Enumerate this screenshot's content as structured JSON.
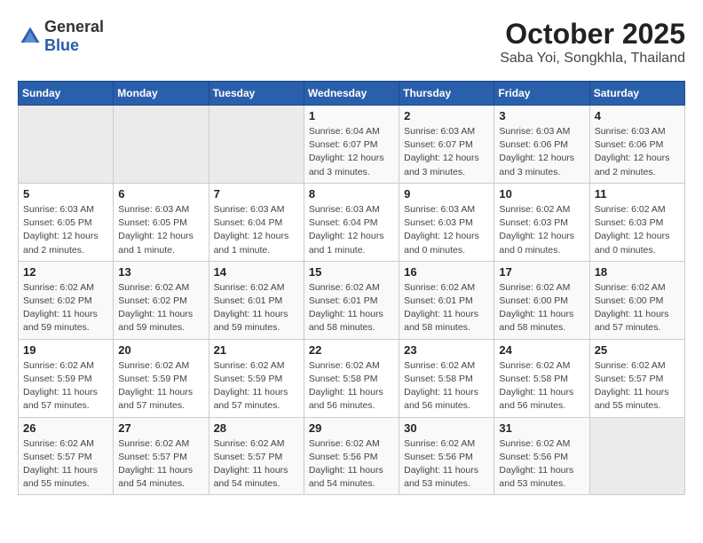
{
  "header": {
    "logo": {
      "general": "General",
      "blue": "Blue"
    },
    "title": "October 2025",
    "subtitle": "Saba Yoi, Songkhla, Thailand"
  },
  "calendar": {
    "weekdays": [
      "Sunday",
      "Monday",
      "Tuesday",
      "Wednesday",
      "Thursday",
      "Friday",
      "Saturday"
    ],
    "weeks": [
      [
        {
          "day": "",
          "empty": true
        },
        {
          "day": "",
          "empty": true
        },
        {
          "day": "",
          "empty": true
        },
        {
          "day": "1",
          "sunrise": "6:04 AM",
          "sunset": "6:07 PM",
          "daylight": "12 hours and 3 minutes."
        },
        {
          "day": "2",
          "sunrise": "6:03 AM",
          "sunset": "6:07 PM",
          "daylight": "12 hours and 3 minutes."
        },
        {
          "day": "3",
          "sunrise": "6:03 AM",
          "sunset": "6:06 PM",
          "daylight": "12 hours and 3 minutes."
        },
        {
          "day": "4",
          "sunrise": "6:03 AM",
          "sunset": "6:06 PM",
          "daylight": "12 hours and 2 minutes."
        }
      ],
      [
        {
          "day": "5",
          "sunrise": "6:03 AM",
          "sunset": "6:05 PM",
          "daylight": "12 hours and 2 minutes."
        },
        {
          "day": "6",
          "sunrise": "6:03 AM",
          "sunset": "6:05 PM",
          "daylight": "12 hours and 1 minute."
        },
        {
          "day": "7",
          "sunrise": "6:03 AM",
          "sunset": "6:04 PM",
          "daylight": "12 hours and 1 minute."
        },
        {
          "day": "8",
          "sunrise": "6:03 AM",
          "sunset": "6:04 PM",
          "daylight": "12 hours and 1 minute."
        },
        {
          "day": "9",
          "sunrise": "6:03 AM",
          "sunset": "6:03 PM",
          "daylight": "12 hours and 0 minutes."
        },
        {
          "day": "10",
          "sunrise": "6:02 AM",
          "sunset": "6:03 PM",
          "daylight": "12 hours and 0 minutes."
        },
        {
          "day": "11",
          "sunrise": "6:02 AM",
          "sunset": "6:03 PM",
          "daylight": "12 hours and 0 minutes."
        }
      ],
      [
        {
          "day": "12",
          "sunrise": "6:02 AM",
          "sunset": "6:02 PM",
          "daylight": "11 hours and 59 minutes."
        },
        {
          "day": "13",
          "sunrise": "6:02 AM",
          "sunset": "6:02 PM",
          "daylight": "11 hours and 59 minutes."
        },
        {
          "day": "14",
          "sunrise": "6:02 AM",
          "sunset": "6:01 PM",
          "daylight": "11 hours and 59 minutes."
        },
        {
          "day": "15",
          "sunrise": "6:02 AM",
          "sunset": "6:01 PM",
          "daylight": "11 hours and 58 minutes."
        },
        {
          "day": "16",
          "sunrise": "6:02 AM",
          "sunset": "6:01 PM",
          "daylight": "11 hours and 58 minutes."
        },
        {
          "day": "17",
          "sunrise": "6:02 AM",
          "sunset": "6:00 PM",
          "daylight": "11 hours and 58 minutes."
        },
        {
          "day": "18",
          "sunrise": "6:02 AM",
          "sunset": "6:00 PM",
          "daylight": "11 hours and 57 minutes."
        }
      ],
      [
        {
          "day": "19",
          "sunrise": "6:02 AM",
          "sunset": "5:59 PM",
          "daylight": "11 hours and 57 minutes."
        },
        {
          "day": "20",
          "sunrise": "6:02 AM",
          "sunset": "5:59 PM",
          "daylight": "11 hours and 57 minutes."
        },
        {
          "day": "21",
          "sunrise": "6:02 AM",
          "sunset": "5:59 PM",
          "daylight": "11 hours and 57 minutes."
        },
        {
          "day": "22",
          "sunrise": "6:02 AM",
          "sunset": "5:58 PM",
          "daylight": "11 hours and 56 minutes."
        },
        {
          "day": "23",
          "sunrise": "6:02 AM",
          "sunset": "5:58 PM",
          "daylight": "11 hours and 56 minutes."
        },
        {
          "day": "24",
          "sunrise": "6:02 AM",
          "sunset": "5:58 PM",
          "daylight": "11 hours and 56 minutes."
        },
        {
          "day": "25",
          "sunrise": "6:02 AM",
          "sunset": "5:57 PM",
          "daylight": "11 hours and 55 minutes."
        }
      ],
      [
        {
          "day": "26",
          "sunrise": "6:02 AM",
          "sunset": "5:57 PM",
          "daylight": "11 hours and 55 minutes."
        },
        {
          "day": "27",
          "sunrise": "6:02 AM",
          "sunset": "5:57 PM",
          "daylight": "11 hours and 54 minutes."
        },
        {
          "day": "28",
          "sunrise": "6:02 AM",
          "sunset": "5:57 PM",
          "daylight": "11 hours and 54 minutes."
        },
        {
          "day": "29",
          "sunrise": "6:02 AM",
          "sunset": "5:56 PM",
          "daylight": "11 hours and 54 minutes."
        },
        {
          "day": "30",
          "sunrise": "6:02 AM",
          "sunset": "5:56 PM",
          "daylight": "11 hours and 53 minutes."
        },
        {
          "day": "31",
          "sunrise": "6:02 AM",
          "sunset": "5:56 PM",
          "daylight": "11 hours and 53 minutes."
        },
        {
          "day": "",
          "empty": true
        }
      ]
    ]
  }
}
